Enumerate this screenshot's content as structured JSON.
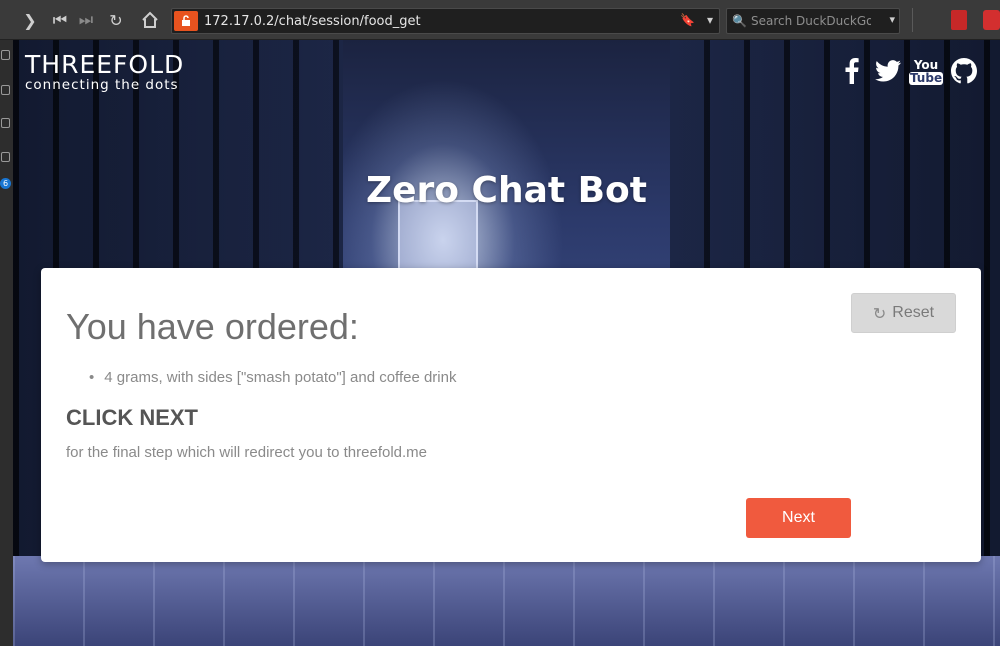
{
  "browser": {
    "url": "172.17.0.2/chat/session/food_get",
    "search_placeholder": "Search DuckDuckGo",
    "sidebar_badge": "6"
  },
  "header": {
    "logo_name": "THREEFOLD",
    "logo_tagline": "connecting the dots",
    "social_icons": [
      "facebook-icon",
      "twitter-icon",
      "youtube-icon",
      "github-icon"
    ],
    "youtube_label_top": "You",
    "youtube_label_bottom": "Tube"
  },
  "hero": {
    "title": "Zero Chat Bot"
  },
  "card": {
    "reset_label": "Reset",
    "heading": "You have ordered:",
    "order_items": [
      "4 grams, with sides [\"smash potato\"] and coffee drink"
    ],
    "subheading": "CLICK NEXT",
    "note": "for the final step which will redirect you to threefold.me",
    "next_label": "Next"
  },
  "colors": {
    "accent": "#f05a3e",
    "reset_bg": "#d9d9d9",
    "lock_badge": "#e8531f"
  }
}
